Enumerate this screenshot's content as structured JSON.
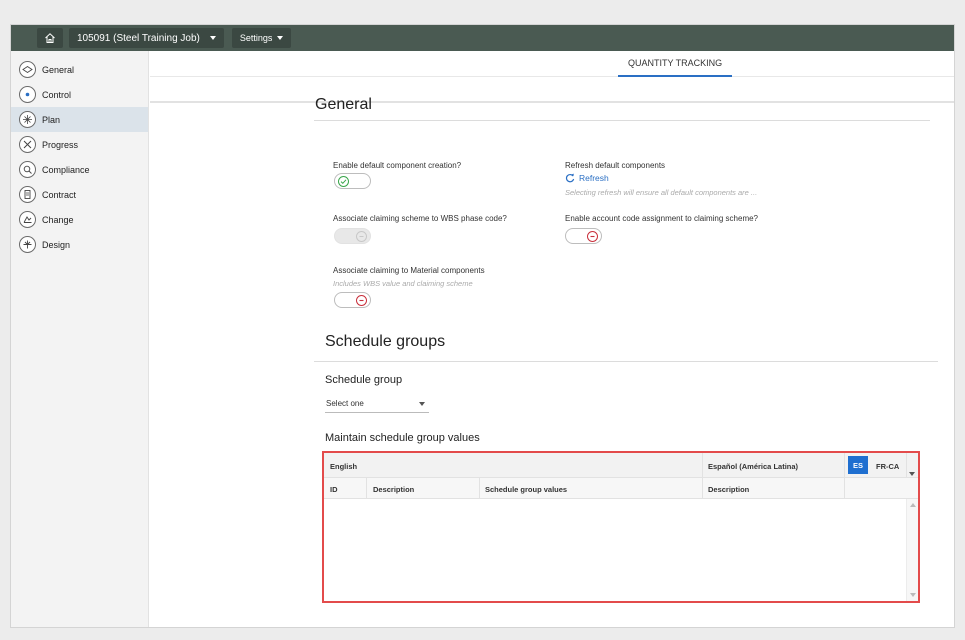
{
  "topbar": {
    "job_label": "105091 (Steel Training Job)",
    "settings_label": "Settings"
  },
  "sidebar": {
    "items": [
      {
        "label": "General",
        "icon": "general-icon"
      },
      {
        "label": "Control",
        "icon": "control-icon"
      },
      {
        "label": "Plan",
        "icon": "plan-icon",
        "active": true
      },
      {
        "label": "Progress",
        "icon": "progress-icon"
      },
      {
        "label": "Compliance",
        "icon": "compliance-icon"
      },
      {
        "label": "Contract",
        "icon": "contract-icon"
      },
      {
        "label": "Change",
        "icon": "change-icon"
      },
      {
        "label": "Design",
        "icon": "design-icon"
      }
    ]
  },
  "tabs": {
    "active": "QUANTITY TRACKING"
  },
  "general": {
    "title": "General",
    "enable_default": {
      "label": "Enable default component creation?",
      "state": "on"
    },
    "refresh_default": {
      "label": "Refresh default components",
      "link": "Refresh",
      "hint": "Selecting refresh will ensure all default components are ..."
    },
    "assoc_wbs": {
      "label": "Associate claiming scheme to WBS phase code?",
      "state": "disabled"
    },
    "enable_account": {
      "label": "Enable account code assignment to claiming scheme?",
      "state": "off"
    },
    "assoc_material": {
      "label": "Associate claiming to Material components",
      "hint": "Includes WBS value and claiming scheme",
      "state": "off"
    }
  },
  "schedule": {
    "title": "Schedule groups",
    "group_label": "Schedule group",
    "select_value": "Select one",
    "maintain_label": "Maintain schedule group values"
  },
  "grid": {
    "lang_english": "English",
    "lang_spanish": "Español (América Latina)",
    "lang_es": "ES",
    "lang_frca": "FR-CA",
    "columns": [
      "ID",
      "Description",
      "Schedule group values",
      "Description"
    ]
  },
  "colors": {
    "accent": "#2a6fc4",
    "topbar": "#4a5a52",
    "highlight": "#e34b4b"
  }
}
